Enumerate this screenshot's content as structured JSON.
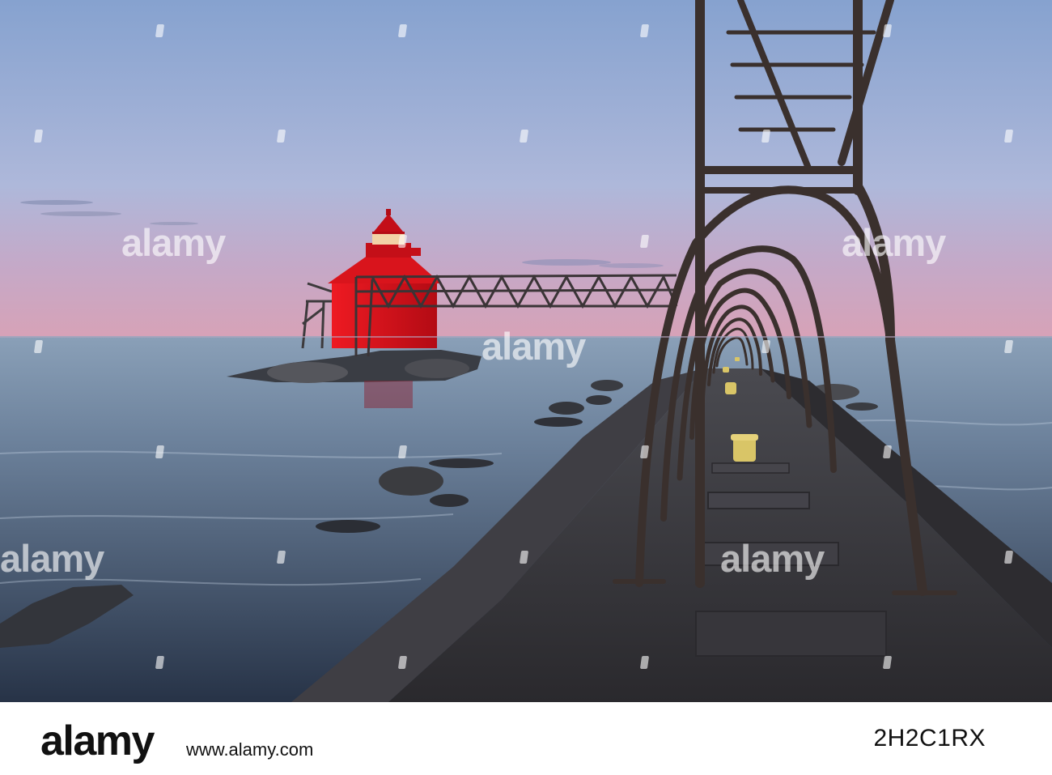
{
  "photo": {
    "subject": "",
    "colors": {
      "sky_top": "#8fa6cd",
      "sky_horizon": "#c8a0b5",
      "water": "#52677f",
      "lighthouse": "#d8101a",
      "pier": "#3b3a3f",
      "bollard": "#d8c462"
    }
  },
  "watermark": {
    "text": "alamy"
  },
  "footer": {
    "logo": "alamy",
    "image_id": "2H2C1RX",
    "url": "www.alamy.com"
  }
}
